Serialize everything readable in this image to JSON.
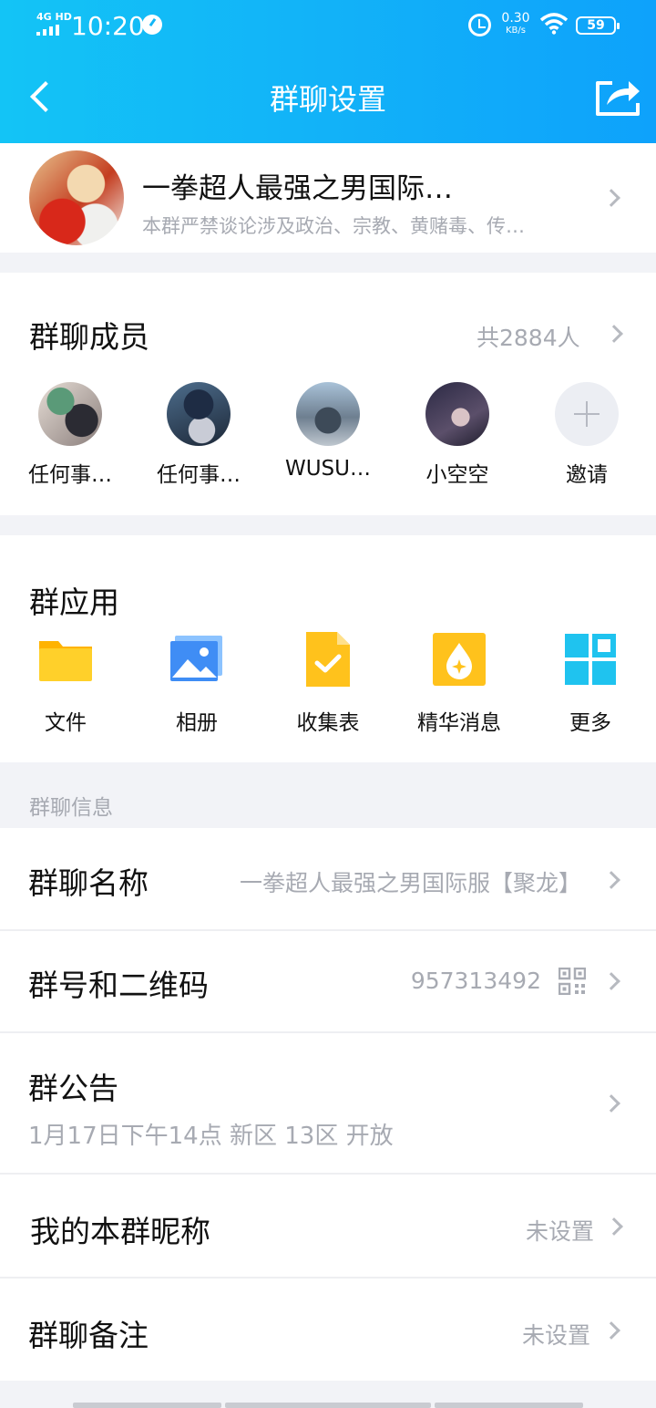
{
  "status_bar": {
    "network": "4G HD",
    "time": "10:20",
    "speed_value": "0.30",
    "speed_unit": "KB/s",
    "battery": "59"
  },
  "nav": {
    "title": "群聊设置",
    "back_icon": "chevron-left-icon",
    "share_icon": "share-icon"
  },
  "group": {
    "name": "一拳超人最强之男国际…",
    "description": "本群严禁谈论涉及政治、宗教、黄赌毒、传…"
  },
  "members": {
    "title": "群聊成员",
    "count_label": "共2884人",
    "list": [
      {
        "name": "任何事…",
        "color": "#6b7f6a"
      },
      {
        "name": "任何事…",
        "color": "#3a5470"
      },
      {
        "name": "WUSU…",
        "color": "#7b8894"
      },
      {
        "name": "小空空",
        "color": "#3c3650"
      }
    ],
    "invite_label": "邀请"
  },
  "apps": {
    "title": "群应用",
    "items": [
      {
        "label": "文件",
        "icon": "folder-icon",
        "color": "#ffc21c"
      },
      {
        "label": "相册",
        "icon": "photo-album-icon",
        "color": "#3a8ef6"
      },
      {
        "label": "收集表",
        "icon": "form-check-icon",
        "color": "#ffc21c"
      },
      {
        "label": "精华消息",
        "icon": "essence-icon",
        "color": "#ffc21c"
      },
      {
        "label": "更多",
        "icon": "grid-more-icon",
        "color": "#1fc3ef"
      }
    ]
  },
  "info": {
    "section_label": "群聊信息",
    "name_row": {
      "title": "群聊名称",
      "value": "一拳超人最强之男国际服【聚龙】"
    },
    "number_row": {
      "title": "群号和二维码",
      "value": "957313492"
    },
    "notice_row": {
      "title": "群公告",
      "value": "1月17日下午14点 新区 13区 开放"
    },
    "nickname_row": {
      "title": "我的本群昵称",
      "value": "未设置"
    },
    "remark_row": {
      "title": "群聊备注",
      "value": "未设置"
    }
  }
}
